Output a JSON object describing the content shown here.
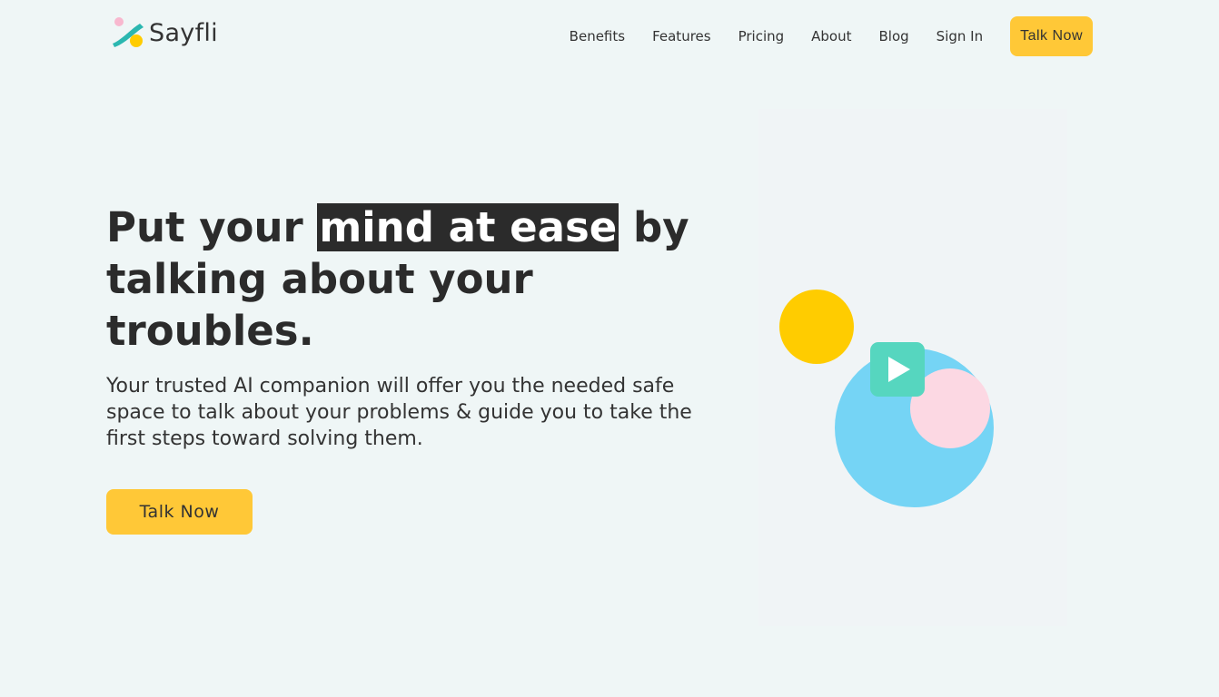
{
  "brand": {
    "name": "Sayfli"
  },
  "nav": {
    "items": [
      "Benefits",
      "Features",
      "Pricing",
      "About",
      "Blog",
      "Sign In"
    ],
    "cta": "Talk Now"
  },
  "hero": {
    "title_before": "Put your ",
    "title_highlight": "mind at ease",
    "title_after": " by talking about your troubles.",
    "subtitle": "Your trusted AI companion will offer you the needed safe space to talk about your problems & guide you to take the first steps toward solving them.",
    "cta": "Talk Now"
  },
  "colors": {
    "accent": "#ffc837",
    "teal": "#56d6bf",
    "blue": "#75d4f5",
    "pink": "#fcd8e3",
    "yellow": "#ffcc00"
  }
}
